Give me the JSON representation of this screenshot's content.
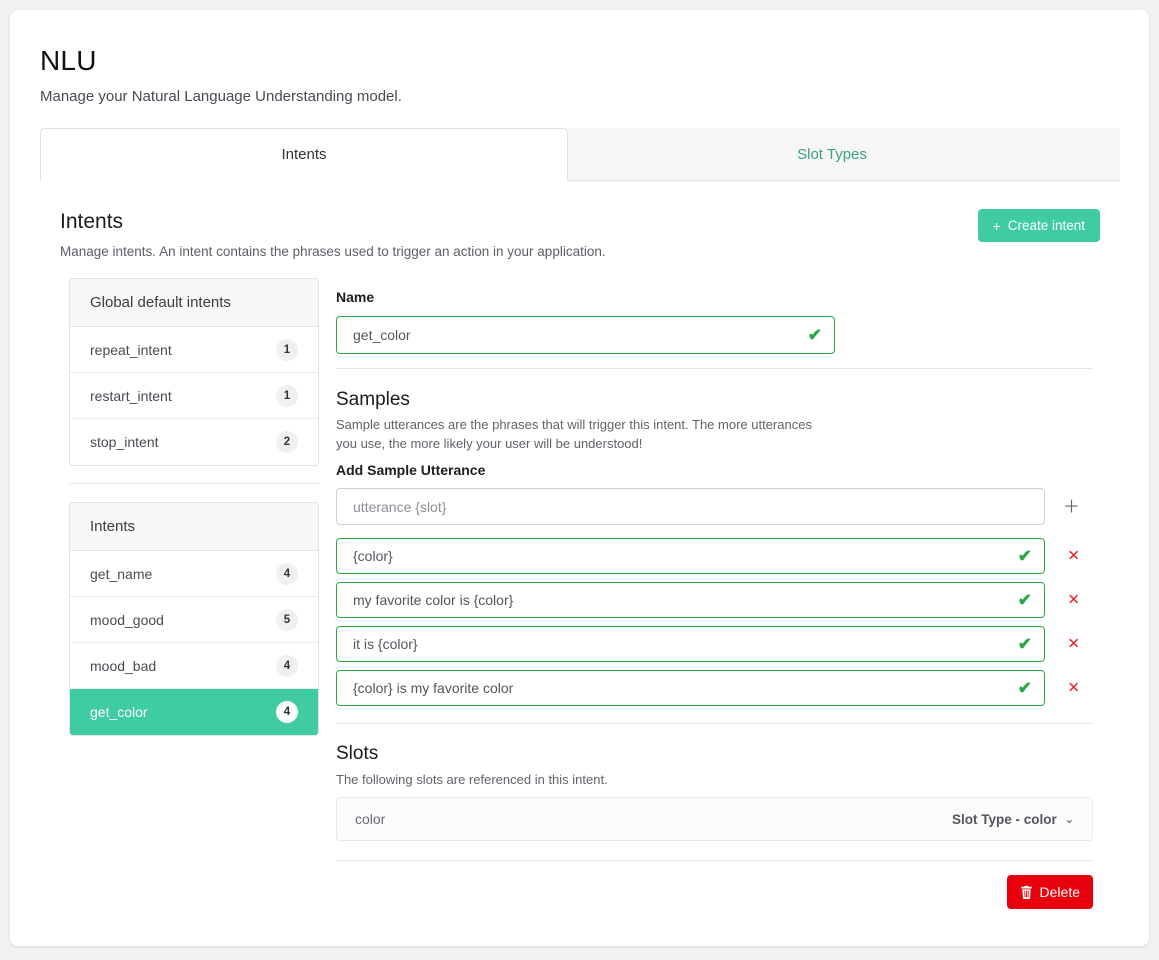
{
  "header": {
    "title": "NLU",
    "subtitle": "Manage your Natural Language Understanding model."
  },
  "tabs": [
    {
      "label": "Intents",
      "active": true
    },
    {
      "label": "Slot Types",
      "active": false
    }
  ],
  "section": {
    "title": "Intents",
    "subtitle": "Manage intents. An intent contains the phrases used to trigger an action in your application.",
    "create_button": "Create intent",
    "create_plus": "+"
  },
  "global_intents": {
    "header": "Global default intents",
    "rows": [
      {
        "name": "repeat_intent",
        "count": "1"
      },
      {
        "name": "restart_intent",
        "count": "1"
      },
      {
        "name": "stop_intent",
        "count": "2"
      }
    ]
  },
  "intents": {
    "header": "Intents",
    "rows": [
      {
        "name": "get_name",
        "count": "4",
        "selected": false
      },
      {
        "name": "mood_good",
        "count": "5",
        "selected": false
      },
      {
        "name": "mood_bad",
        "count": "4",
        "selected": false
      },
      {
        "name": "get_color",
        "count": "4",
        "selected": true
      }
    ]
  },
  "detail": {
    "name_label": "Name",
    "name_value": "get_color",
    "name_valid_icon": "✔",
    "samples_title": "Samples",
    "samples_desc": "Sample utterances are the phrases that will trigger this intent. The more utterances you use, the more likely your user will be understood!",
    "add_utterance_label": "Add Sample Utterance",
    "add_utterance_placeholder": "utterance {slot}",
    "add_icon": "＋",
    "remove_icon": "✕",
    "valid_icon": "✔",
    "utterances": [
      "{color}",
      "my favorite color is {color}",
      "it is {color}",
      "{color} is my favorite color"
    ],
    "slots_title": "Slots",
    "slots_desc": "The following slots are referenced in this intent.",
    "slots": [
      {
        "name": "color",
        "type": "Slot Type - color",
        "chevron": "⌄"
      }
    ],
    "delete_label": "Delete",
    "delete_icon": "🗑"
  },
  "colors": {
    "accent": "#3fcca0",
    "valid": "#2aa745",
    "danger": "#e8000d",
    "tab_link": "#3aa37e"
  }
}
